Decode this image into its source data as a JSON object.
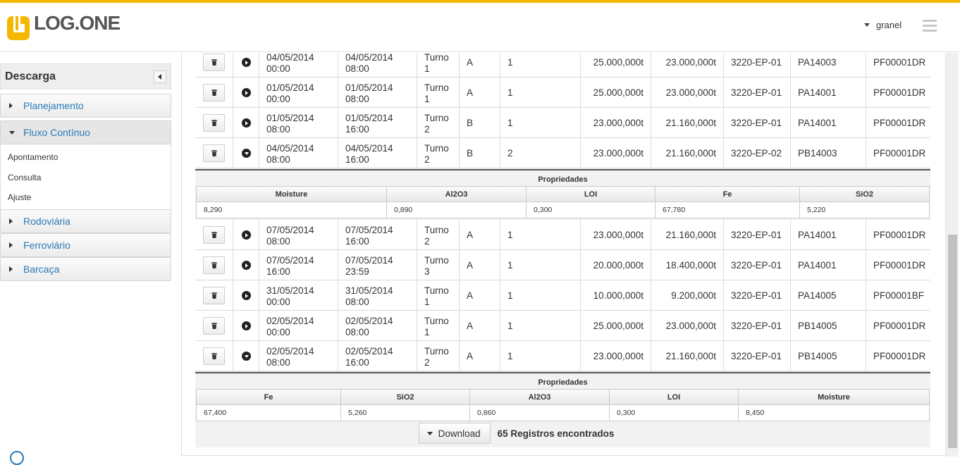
{
  "header": {
    "logo_text": "LOG.ONE",
    "user": "granel",
    "accent": "#f5b800"
  },
  "sidebar": {
    "title": "Descarga",
    "items": [
      {
        "label": "Planejamento"
      },
      {
        "label": "Fluxo Contínuo",
        "expanded": true,
        "children": [
          "Apontamento",
          "Consulta",
          "Ajuste"
        ]
      },
      {
        "label": "Rodoviária"
      },
      {
        "label": "Ferroviário"
      },
      {
        "label": "Barcaça"
      }
    ]
  },
  "rows_top": [
    {
      "ini": [
        "04/05/2014",
        "00:00"
      ],
      "fim": [
        "04/05/2014",
        "08:00"
      ],
      "turno": [
        "Turno",
        "1"
      ],
      "eq": "A",
      "n": "1",
      "prev": "25.000,000t",
      "real": "23.000,000t",
      "eqp": "3220-EP-01",
      "lote": "PA14003",
      "prod": "PF00001DR",
      "expanded": false
    },
    {
      "ini": [
        "01/05/2014",
        "00:00"
      ],
      "fim": [
        "01/05/2014",
        "08:00"
      ],
      "turno": [
        "Turno",
        "1"
      ],
      "eq": "A",
      "n": "1",
      "prev": "25.000,000t",
      "real": "23.000,000t",
      "eqp": "3220-EP-01",
      "lote": "PA14001",
      "prod": "PF00001DR",
      "expanded": false
    },
    {
      "ini": [
        "01/05/2014",
        "08:00"
      ],
      "fim": [
        "01/05/2014",
        "16:00"
      ],
      "turno": [
        "Turno",
        "2"
      ],
      "eq": "B",
      "n": "1",
      "prev": "23.000,000t",
      "real": "21.160,000t",
      "eqp": "3220-EP-01",
      "lote": "PA14001",
      "prod": "PF00001DR",
      "expanded": false
    },
    {
      "ini": [
        "04/05/2014",
        "08:00"
      ],
      "fim": [
        "04/05/2014",
        "16:00"
      ],
      "turno": [
        "Turno",
        "2"
      ],
      "eq": "B",
      "n": "2",
      "prev": "23.000,000t",
      "real": "21.160,000t",
      "eqp": "3220-EP-02",
      "lote": "PB14003",
      "prod": "PF00001DR",
      "expanded": true
    }
  ],
  "props1": {
    "title": "Propriedades",
    "headers": [
      "Moisture",
      "Al2O3",
      "LOI",
      "Fe",
      "SiO2"
    ],
    "values": [
      "8,290",
      "0,890",
      "0,300",
      "67,780",
      "5,220"
    ]
  },
  "rows_mid": [
    {
      "ini": [
        "07/05/2014",
        "08:00"
      ],
      "fim": [
        "07/05/2014",
        "16:00"
      ],
      "turno": [
        "Turno",
        "2"
      ],
      "eq": "A",
      "n": "1",
      "prev": "23.000,000t",
      "real": "21.160,000t",
      "eqp": "3220-EP-01",
      "lote": "PA14001",
      "prod": "PF00001DR",
      "expanded": false
    },
    {
      "ini": [
        "07/05/2014",
        "16:00"
      ],
      "fim": [
        "07/05/2014",
        "23:59"
      ],
      "turno": [
        "Turno",
        "3"
      ],
      "eq": "A",
      "n": "1",
      "prev": "20.000,000t",
      "real": "18.400,000t",
      "eqp": "3220-EP-01",
      "lote": "PA14001",
      "prod": "PF00001DR",
      "expanded": false
    },
    {
      "ini": [
        "31/05/2014",
        "00:00"
      ],
      "fim": [
        "31/05/2014",
        "08:00"
      ],
      "turno": [
        "Turno",
        "1"
      ],
      "eq": "A",
      "n": "1",
      "prev": "10.000,000t",
      "real": "9.200,000t",
      "eqp": "3220-EP-01",
      "lote": "PA14005",
      "prod": "PF00001BF",
      "expanded": false
    },
    {
      "ini": [
        "02/05/2014",
        "00:00"
      ],
      "fim": [
        "02/05/2014",
        "08:00"
      ],
      "turno": [
        "Turno",
        "1"
      ],
      "eq": "A",
      "n": "1",
      "prev": "25.000,000t",
      "real": "23.000,000t",
      "eqp": "3220-EP-01",
      "lote": "PB14005",
      "prod": "PF00001DR",
      "expanded": false
    },
    {
      "ini": [
        "02/05/2014",
        "08:00"
      ],
      "fim": [
        "02/05/2014",
        "16:00"
      ],
      "turno": [
        "Turno",
        "2"
      ],
      "eq": "A",
      "n": "1",
      "prev": "23.000,000t",
      "real": "21.160,000t",
      "eqp": "3220-EP-01",
      "lote": "PB14005",
      "prod": "PF00001DR",
      "expanded": true
    }
  ],
  "props2": {
    "title": "Propriedades",
    "headers": [
      "Fe",
      "SiO2",
      "Al2O3",
      "LOI",
      "Moisture"
    ],
    "values": [
      "67,400",
      "5,260",
      "0,860",
      "0,300",
      "8,450"
    ]
  },
  "footer": {
    "download_label": "Download",
    "count_label": "65 Registros encontrados"
  }
}
